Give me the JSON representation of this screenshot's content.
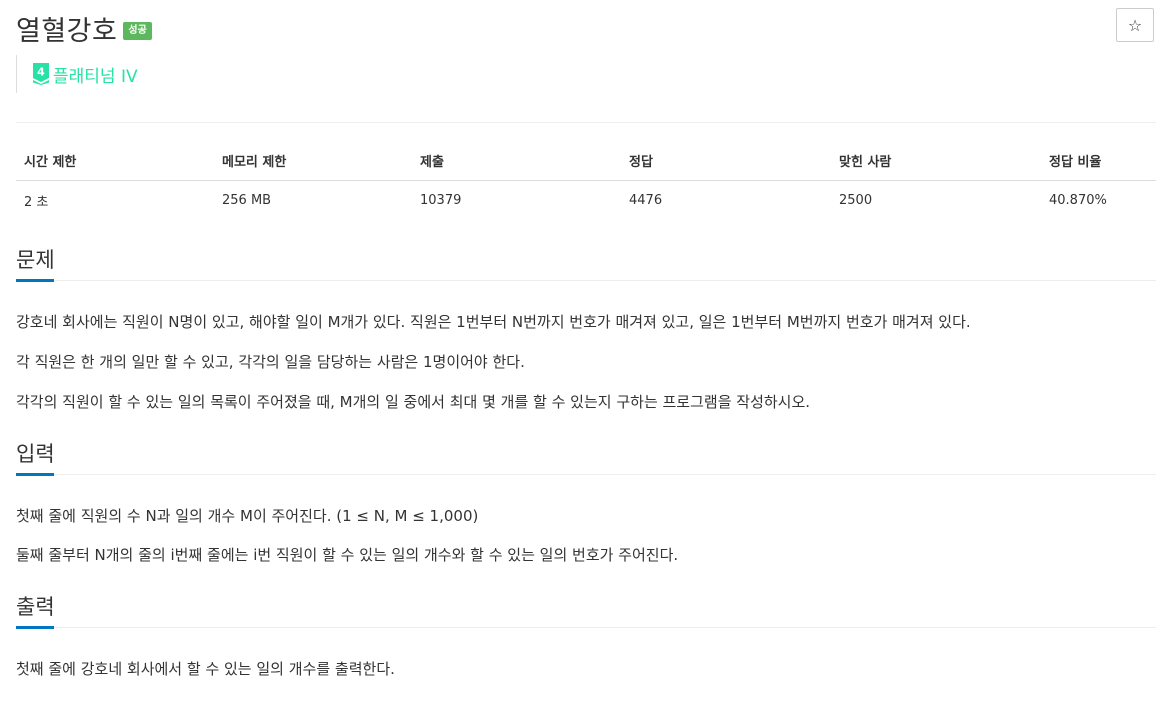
{
  "problem": {
    "title": "열혈강호",
    "status_badge": "성공",
    "star_icon": "☆",
    "tier_number": "4",
    "tier_label": "플래티넘 IV",
    "tier_color": "#27e2a4"
  },
  "info_table": {
    "headers": [
      "시간 제한",
      "메모리 제한",
      "제출",
      "정답",
      "맞힌 사람",
      "정답 비율"
    ],
    "values": [
      "2 초",
      "256 MB",
      "10379",
      "4476",
      "2500",
      "40.870%"
    ]
  },
  "sections": {
    "problem": {
      "heading": "문제",
      "paragraphs": [
        "강호네 회사에는 직원이 N명이 있고, 해야할 일이 M개가 있다. 직원은 1번부터 N번까지 번호가 매겨져 있고, 일은 1번부터 M번까지 번호가 매겨져 있다.",
        "각 직원은 한 개의 일만 할 수 있고, 각각의 일을 담당하는 사람은 1명이어야 한다.",
        "각각의 직원이 할 수 있는 일의 목록이 주어졌을 때, M개의 일 중에서 최대 몇 개를 할 수 있는지 구하는 프로그램을 작성하시오."
      ]
    },
    "input": {
      "heading": "입력",
      "paragraphs": [
        "첫째 줄에 직원의 수 N과 일의 개수 M이 주어진다. (1 ≤ N, M ≤ 1,000)",
        "둘째 줄부터 N개의 줄의 i번째 줄에는 i번 직원이 할 수 있는 일의 개수와 할 수 있는 일의 번호가 주어진다."
      ]
    },
    "output": {
      "heading": "출력",
      "paragraphs": [
        "첫째 줄에 강호네 회사에서 할 수 있는 일의 개수를 출력한다."
      ]
    }
  },
  "colors": {
    "badge_success": "#5cb85c",
    "section_accent": "#0076c0"
  }
}
